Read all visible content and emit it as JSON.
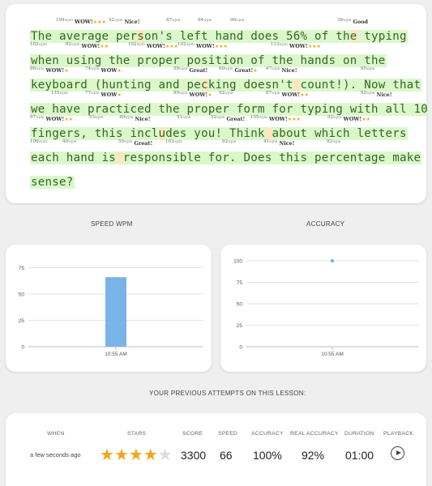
{
  "typing": {
    "lines": [
      "The average person's left hand does 56% of the typing",
      "when using the proper position of the hands on the",
      "keyboard (hunting and pecking doesn't count!). Now that",
      "we have practiced the proper form for typing with all 10",
      "fingers, this includes you! Think about which letters",
      "each hand is responsible for. Does this percentage make",
      "sense?"
    ],
    "wpm_rows": [
      [
        {
          "n": "109",
          "l": "WOW!",
          "s": "★★★"
        },
        {
          "n": "42",
          "l": "Nice!",
          "s": ""
        },
        {
          "n": "87",
          "l": "",
          "s": ""
        },
        {
          "n": "94",
          "l": "",
          "s": ""
        },
        {
          "n": "96",
          "l": "",
          "s": ""
        },
        {
          "n": "38",
          "l": "Good",
          "s": ""
        }
      ],
      [
        {
          "n": "102",
          "l": "",
          "s": ""
        },
        {
          "n": "82",
          "l": "WOW!",
          "s": "★★"
        },
        {
          "n": "102",
          "l": "WOW!",
          "s": "★★★"
        },
        {
          "n": "102",
          "l": "WOW!",
          "s": "★★★"
        },
        {
          "n": "113",
          "l": "WOW!",
          "s": "★★★"
        }
      ],
      [
        {
          "n": "86",
          "l": "WOW!",
          "s": "★"
        },
        {
          "n": "74",
          "l": "WOW",
          "s": "★"
        },
        {
          "n": "59",
          "l": "Great!",
          "s": ""
        },
        {
          "n": "60",
          "l": "Great!",
          "s": "★"
        },
        {
          "n": "47",
          "l": "Nice!",
          "s": ""
        },
        {
          "n": "95",
          "l": "",
          "s": ""
        }
      ],
      [
        {
          "n": "115",
          "l": "",
          "s": ""
        },
        {
          "n": "77",
          "l": "WOW",
          "s": "★"
        },
        {
          "n": "89",
          "l": "WOW!",
          "s": "★"
        },
        {
          "n": "92",
          "l": "",
          "s": ""
        },
        {
          "n": "87",
          "l": "WOW!",
          "s": "★★"
        },
        {
          "n": "92",
          "l": "Nice!",
          "s": ""
        }
      ],
      [
        {
          "n": "97",
          "l": "WOW!",
          "s": "★★"
        },
        {
          "n": "53",
          "l": "",
          "s": ""
        },
        {
          "n": "40",
          "l": "Nice!",
          "s": ""
        },
        {
          "n": "51",
          "l": "",
          "s": ""
        },
        {
          "n": "52",
          "l": "Great!",
          "s": ""
        },
        {
          "n": "105",
          "l": "WOW!",
          "s": "★★★"
        },
        {
          "n": "92",
          "l": "WOW!",
          "s": "★★"
        }
      ],
      [
        {
          "n": "100",
          "l": "",
          "s": ""
        },
        {
          "n": "40",
          "l": "",
          "s": ""
        },
        {
          "n": "50",
          "l": "Great!",
          "s": ""
        },
        {
          "n": "103",
          "l": "",
          "s": ""
        },
        {
          "n": "92",
          "l": "",
          "s": ""
        },
        {
          "n": "41",
          "l": "Nice!",
          "s": ""
        },
        {
          "n": "92",
          "l": "",
          "s": ""
        }
      ]
    ],
    "wpm_unit": "wpm"
  },
  "speed_chart_label": "SPEED WPM",
  "accuracy_chart_label": "ACCURACY",
  "chart_data": [
    {
      "type": "bar",
      "categories": [
        "10:55 AM"
      ],
      "values": [
        66
      ],
      "yticks": [
        0,
        25,
        50,
        75
      ],
      "ylim": [
        0,
        80
      ],
      "title": "SPEED WPM",
      "color": "#7ab3e8"
    },
    {
      "type": "scatter",
      "x": [
        "10:55 AM"
      ],
      "values": [
        100
      ],
      "yticks": [
        0,
        25,
        50,
        75,
        100
      ],
      "ylim": [
        0,
        100
      ],
      "title": "ACCURACY",
      "color": "#7ab3e8"
    }
  ],
  "attempts": {
    "title": "YOUR PREVIOUS ATTEMPTS ON THIS LESSON:",
    "headers": {
      "when": "WHEN",
      "stars": "STARS",
      "score": "SCORE",
      "speed": "SPEED",
      "accuracy": "ACCURACY",
      "real_accuracy": "REAL ACCURACY",
      "duration": "DURATION",
      "playback": "PLAYBACK"
    },
    "row": {
      "when": "a few seconds ago",
      "stars_filled": 4,
      "stars_total": 5,
      "score": "3300",
      "speed": "66",
      "accuracy": "100%",
      "real_accuracy": "92%",
      "duration": "01:00"
    }
  },
  "colors": {
    "typed_bg": "#dcf7cc",
    "error_bg": "#fde6c0",
    "typed_text": "#2f6a1e",
    "star": "#f2a61f",
    "bar": "#7ab3e8"
  }
}
